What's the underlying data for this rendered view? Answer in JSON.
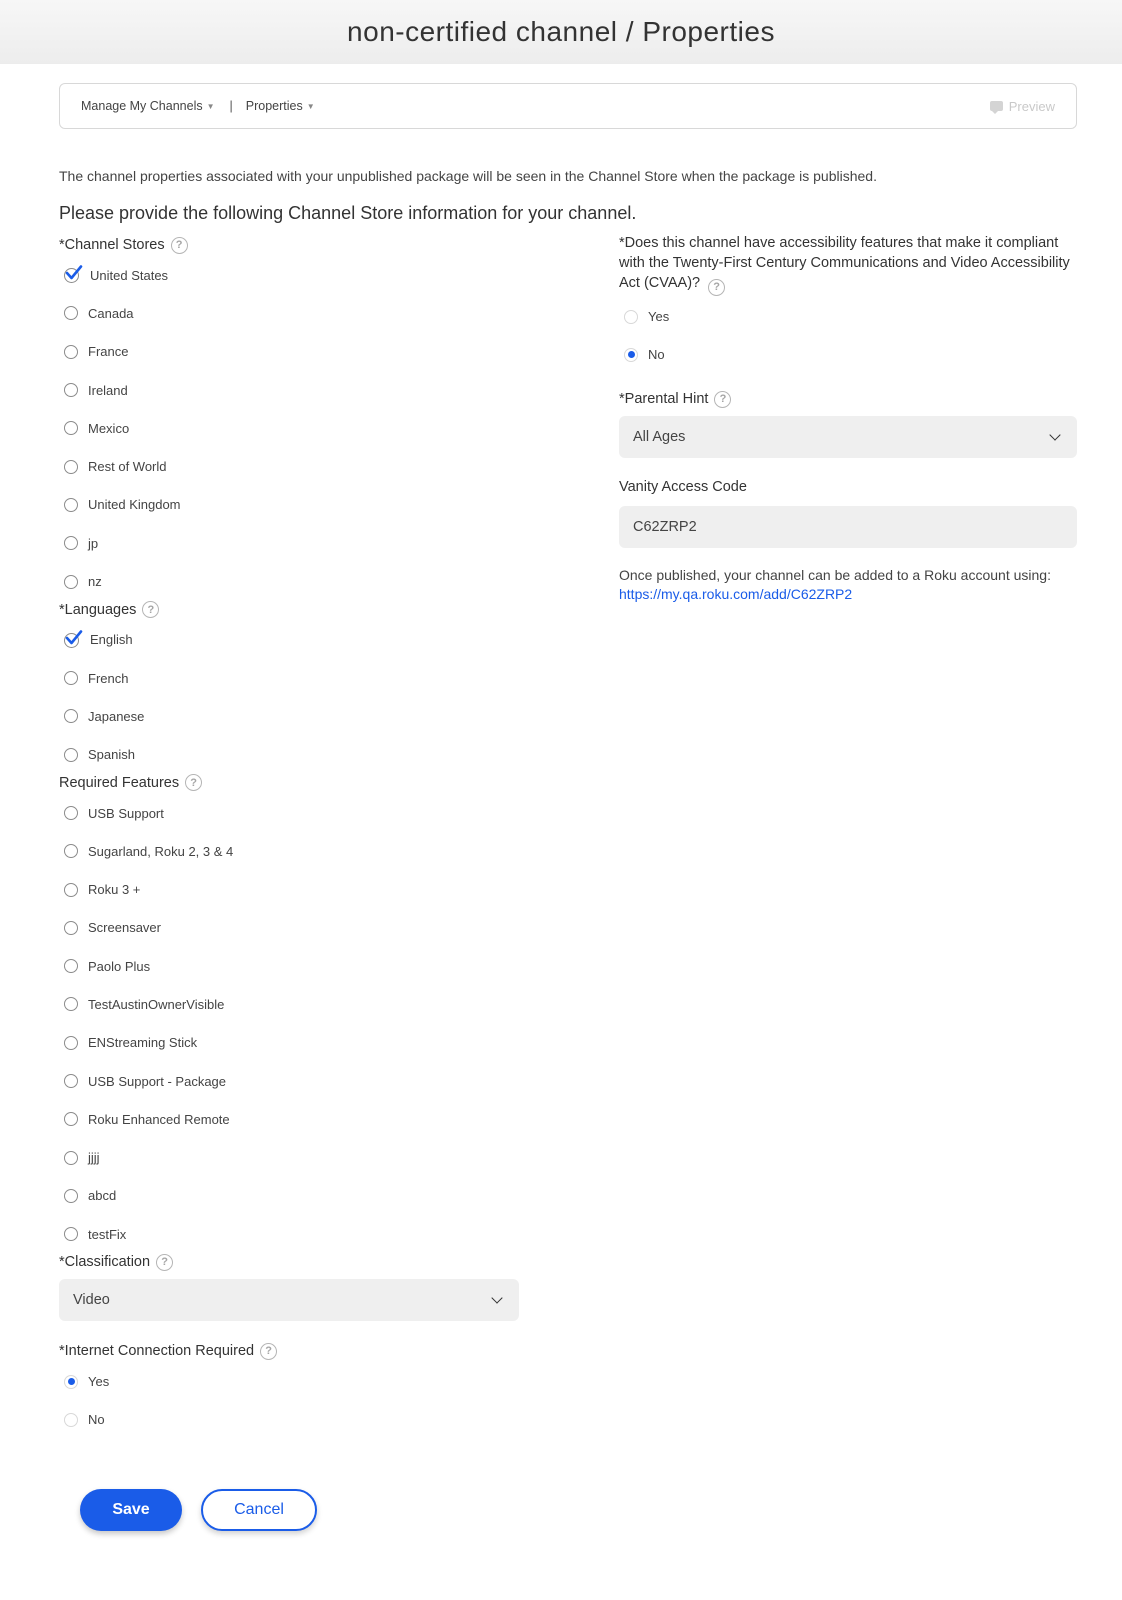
{
  "header": {
    "title": "non-certified channel / Properties"
  },
  "toolbar": {
    "crumb_manage": "Manage My Channels",
    "crumb_properties": "Properties",
    "separator": "|",
    "preview": "Preview"
  },
  "intro": "The channel properties associated with your unpublished package will be seen in the Channel Store when the package is published.",
  "subhead": "Please provide the following Channel Store information for your channel.",
  "channel_stores": {
    "label": "*Channel Stores",
    "items": [
      {
        "label": "United States",
        "checked": true
      },
      {
        "label": "Canada",
        "checked": false
      },
      {
        "label": "France",
        "checked": false
      },
      {
        "label": "Ireland",
        "checked": false
      },
      {
        "label": "Mexico",
        "checked": false
      },
      {
        "label": "Rest of World",
        "checked": false
      },
      {
        "label": "United Kingdom",
        "checked": false
      },
      {
        "label": "jp",
        "checked": false
      },
      {
        "label": "nz",
        "checked": false
      }
    ]
  },
  "languages": {
    "label": "*Languages",
    "items": [
      {
        "label": "English",
        "checked": true
      },
      {
        "label": "French",
        "checked": false
      },
      {
        "label": "Japanese",
        "checked": false
      },
      {
        "label": "Spanish",
        "checked": false
      }
    ]
  },
  "required_features": {
    "label": "Required Features",
    "items": [
      {
        "label": "USB Support",
        "checked": false
      },
      {
        "label": "Sugarland, Roku 2, 3 & 4",
        "checked": false
      },
      {
        "label": "Roku 3 +",
        "checked": false
      },
      {
        "label": "Screensaver",
        "checked": false
      },
      {
        "label": "Paolo Plus",
        "checked": false
      },
      {
        "label": "TestAustinOwnerVisible",
        "checked": false
      },
      {
        "label": "ENStreaming Stick",
        "checked": false
      },
      {
        "label": "USB Support - Package",
        "checked": false
      },
      {
        "label": "Roku Enhanced Remote",
        "checked": false
      },
      {
        "label": "jjjj",
        "checked": false
      },
      {
        "label": "abcd",
        "checked": false
      },
      {
        "label": "testFix",
        "checked": false
      }
    ]
  },
  "classification": {
    "label": "*Classification",
    "value": "Video"
  },
  "internet": {
    "label": "*Internet Connection Required",
    "yes": "Yes",
    "no": "No",
    "selected": "Yes"
  },
  "accessibility": {
    "label": "*Does this channel have accessibility features that make it compliant with the Twenty-First Century Communications and Video Accessibility Act (CVAA)?",
    "yes": "Yes",
    "no": "No",
    "selected": "No"
  },
  "parental_hint": {
    "label": "*Parental Hint",
    "value": "All Ages"
  },
  "vanity": {
    "label": "Vanity Access Code",
    "value": "C62ZRP2"
  },
  "publish_note": {
    "text": "Once published, your channel can be added to a Roku account using:",
    "link": "https://my.qa.roku.com/add/C62ZRP2"
  },
  "buttons": {
    "save": "Save",
    "cancel": "Cancel"
  },
  "icons": {
    "help": "question-circle-icon",
    "check": "checkmark-icon",
    "chevron": "chevron-down-icon",
    "preview": "comment-icon"
  },
  "colors": {
    "accent": "#1a5ce8",
    "field_bg": "#efefef"
  }
}
